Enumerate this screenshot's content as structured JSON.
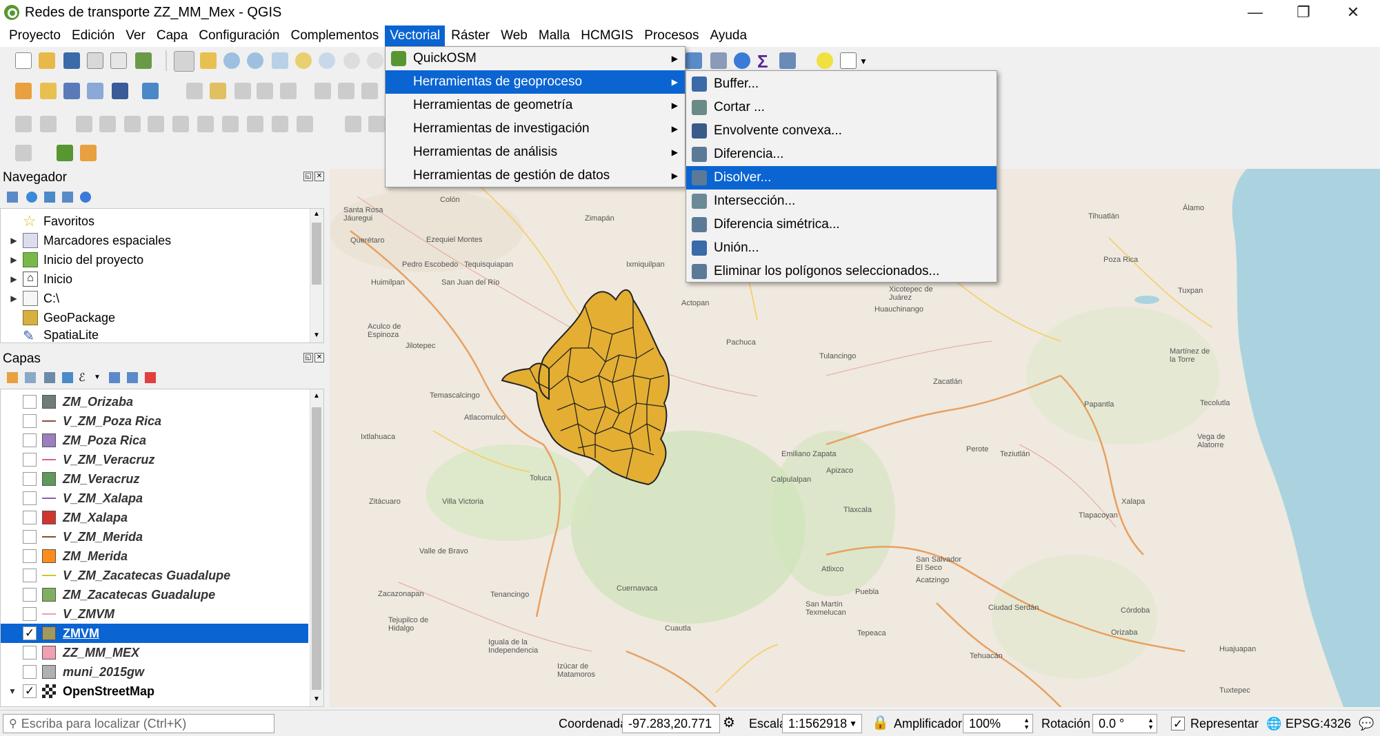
{
  "window": {
    "title": "Redes de transporte ZZ_MM_Mex - QGIS",
    "minimize": "—",
    "restore": "❐",
    "close": "✕"
  },
  "menubar": {
    "items": [
      "Proyecto",
      "Edición",
      "Ver",
      "Capa",
      "Configuración",
      "Complementos",
      "Vectorial",
      "Ráster",
      "Web",
      "Malla",
      "HCMGIS",
      "Procesos",
      "Ayuda"
    ],
    "active": "Vectorial"
  },
  "vector_menu": {
    "items": [
      {
        "label": "QuickOSM",
        "icon": "quickosm-icon"
      },
      {
        "label": "Herramientas de geoproceso",
        "selected": true
      },
      {
        "label": "Herramientas de geometría"
      },
      {
        "label": "Herramientas de investigación"
      },
      {
        "label": "Herramientas de análisis"
      },
      {
        "label": "Herramientas de gestión de datos"
      }
    ]
  },
  "geoprocess_menu": {
    "items": [
      {
        "label": "Buffer...",
        "icon": "buffer-icon"
      },
      {
        "label": "Cortar ...",
        "icon": "clip-icon"
      },
      {
        "label": "Envolvente convexa...",
        "icon": "convex-hull-icon"
      },
      {
        "label": "Diferencia...",
        "icon": "difference-icon"
      },
      {
        "label": "Disolver...",
        "icon": "dissolve-icon",
        "selected": true
      },
      {
        "label": "Intersección...",
        "icon": "intersection-icon"
      },
      {
        "label": "Diferencia simétrica...",
        "icon": "symmetric-difference-icon"
      },
      {
        "label": "Unión...",
        "icon": "union-icon"
      },
      {
        "label": "Eliminar los polígonos seleccionados...",
        "icon": "eliminate-polygons-icon"
      }
    ]
  },
  "navigator": {
    "title": "Navegador",
    "items": [
      {
        "label": "Favoritos",
        "icon": "star-icon",
        "expandable": false
      },
      {
        "label": "Marcadores espaciales",
        "icon": "bookmark-icon",
        "expandable": true
      },
      {
        "label": "Inicio del proyecto",
        "icon": "project-home-icon",
        "expandable": true
      },
      {
        "label": "Inicio",
        "icon": "home-icon",
        "expandable": true
      },
      {
        "label": "C:\\",
        "icon": "folder-icon",
        "expandable": true
      },
      {
        "label": "GeoPackage",
        "icon": "geopackage-icon",
        "expandable": false
      },
      {
        "label": "SpatiaLite",
        "icon": "spatialite-icon",
        "expandable": false
      }
    ]
  },
  "layers": {
    "title": "Capas",
    "items": [
      {
        "label": "ZM_Orizaba",
        "type": "polygon",
        "color": "#707b7c",
        "checked": false
      },
      {
        "label": "V_ZM_Poza Rica",
        "type": "line",
        "color": "#8b4a3c",
        "checked": false
      },
      {
        "label": "ZM_Poza Rica",
        "type": "polygon",
        "color": "#9b7fc0",
        "checked": false
      },
      {
        "label": "V_ZM_Veracruz",
        "type": "line",
        "color": "#e0608a",
        "checked": false
      },
      {
        "label": "ZM_Veracruz",
        "type": "polygon",
        "color": "#5e9a5c",
        "checked": false
      },
      {
        "label": "V_ZM_Xalapa",
        "type": "line",
        "color": "#8a5cb0",
        "checked": false
      },
      {
        "label": "ZM_Xalapa",
        "type": "polygon",
        "color": "#d0352e",
        "checked": false
      },
      {
        "label": "V_ZM_Merida",
        "type": "line",
        "color": "#8b4a3c",
        "checked": false
      },
      {
        "label": "ZM_Merida",
        "type": "polygon",
        "color": "#ff8c1a",
        "checked": false
      },
      {
        "label": "V_ZM_Zacatecas Guadalupe",
        "type": "line",
        "color": "#c8c830",
        "checked": false
      },
      {
        "label": "ZM_Zacatecas Guadalupe",
        "type": "polygon",
        "color": "#7fb060",
        "checked": false
      },
      {
        "label": "V_ZMVM",
        "type": "line",
        "color": "#e8a0b0",
        "checked": false
      },
      {
        "label": "ZMVM",
        "type": "polygon",
        "color": "#a09a60",
        "checked": true,
        "selected": true
      },
      {
        "label": "ZZ_MM_MEX",
        "type": "polygon",
        "color": "#f0a0b0",
        "checked": false
      },
      {
        "label": "muni_2015gw",
        "type": "polygon",
        "color": "#b0b0b0",
        "checked": false
      },
      {
        "label": "OpenStreetMap",
        "type": "raster",
        "color": "#333333",
        "checked": true
      }
    ]
  },
  "map_labels": [
    {
      "text": "Colón"
    },
    {
      "text": "Santa Rosa\nJáuregui"
    },
    {
      "text": "Querétaro"
    },
    {
      "text": "Ezequiel Montes"
    },
    {
      "text": "Pedro Escobedo"
    },
    {
      "text": "Tequisquiapan"
    },
    {
      "text": "Zimapán"
    },
    {
      "text": "Ixmiquilpan"
    },
    {
      "text": "Huimilpan"
    },
    {
      "text": "San Juan del Río"
    },
    {
      "text": "Actopan"
    },
    {
      "text": "Aculco de\nEspinoza"
    },
    {
      "text": "Jilotepec"
    },
    {
      "text": "Pachuca"
    },
    {
      "text": "Tulancingo"
    },
    {
      "text": "Temascalcingo"
    },
    {
      "text": "Atlacomulco"
    },
    {
      "text": "Ixtlahuaca"
    },
    {
      "text": "Toluca"
    },
    {
      "text": "Tenancingo"
    },
    {
      "text": "Cuernavaca"
    },
    {
      "text": "Cuautla"
    },
    {
      "text": "Puebla"
    },
    {
      "text": "Tlaxcala"
    },
    {
      "text": "Tepeaca"
    },
    {
      "text": "Tehuacán"
    },
    {
      "text": "Orizaba"
    },
    {
      "text": "Córdoba"
    },
    {
      "text": "Xalapa"
    },
    {
      "text": "Perote"
    },
    {
      "text": "Poza Rica"
    },
    {
      "text": "Tuxpan"
    },
    {
      "text": "Martínez de\nla Torre"
    },
    {
      "text": "Zacatlán"
    },
    {
      "text": "Huauchinango"
    },
    {
      "text": "Xicotepec de\nJuárez"
    },
    {
      "text": "Papantla"
    },
    {
      "text": "Teziutlán"
    },
    {
      "text": "Ciudad Serdán"
    },
    {
      "text": "Tlapacoyan"
    },
    {
      "text": "Zitácuaro"
    },
    {
      "text": "Villa Victoria"
    },
    {
      "text": "Valle de Bravo"
    },
    {
      "text": "Tejupilco de\nHidalgo"
    },
    {
      "text": "Iguala de la\nIndependencia"
    },
    {
      "text": "Zacazonapan"
    },
    {
      "text": "Huajuapan"
    },
    {
      "text": "Tuxtepec"
    },
    {
      "text": "Tihuatlán"
    },
    {
      "text": "Álamo"
    },
    {
      "text": "Tecolutla"
    },
    {
      "text": "Vega de\nAlatorre"
    },
    {
      "text": "Emiliano Zapata"
    },
    {
      "text": "Apizaco"
    },
    {
      "text": "San Martín\nTexmelucan"
    },
    {
      "text": "Atlixco"
    },
    {
      "text": "Izúcar de\nMatamoros"
    },
    {
      "text": "San Salvador\nEl Seco"
    },
    {
      "text": "Acatzingo"
    },
    {
      "text": "Calpulalpan"
    }
  ],
  "statusbar": {
    "locator_placeholder": "Escriba para localizar (Ctrl+K)",
    "coord_label": "Coordenada",
    "coord_value": "-97.283,20.771",
    "scale_label": "Escala",
    "scale_value": "1:1562918",
    "magnifier_label": "Amplificador",
    "magnifier_value": "100%",
    "rotation_label": "Rotación",
    "rotation_value": "0.0 °",
    "render_label": "Representar",
    "crs": "EPSG:4326"
  },
  "colors": {
    "accent": "#0a64d2",
    "zmvm_fill": "#e3ae32",
    "map_land": "#efe9df",
    "sea": "#aad3df"
  }
}
